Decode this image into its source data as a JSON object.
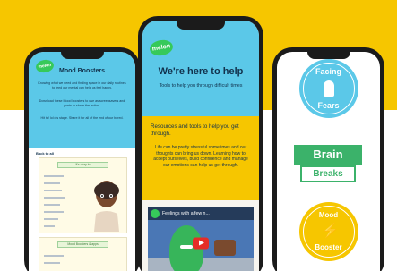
{
  "colors": {
    "accent_yellow": "#f6c600",
    "sky_blue": "#5bc8e8",
    "melon_green": "#36c95a",
    "navy_text": "#12324d",
    "brain_green": "#3bb26a"
  },
  "left_phone": {
    "logo": "melon",
    "title": "Mood Boosters",
    "para1": "Knowing what we need and finding space in our daily routines to feed our mental can help us feel happy.",
    "para2": "Download these Mood boosters to use as screensavers and posts to share the action.",
    "para3": "Hit ta! lol dis stage. Share it for all of the end of our bored.",
    "back_link": "Back to all",
    "card1_header": "It's okay to",
    "card2_header": "Mood Boosters & apps"
  },
  "center_phone": {
    "logo": "melon",
    "title": "We're here to help",
    "subtitle": "Tools to help you through difficult times",
    "resources_heading": "Resources and tools to help you get through.",
    "body": "Life can be pretty stressful sometimes and our thoughts can bring us down. Learning how to accept ourselves, build confidence and manage our emotions can help us get through.",
    "video_title": "Feelings with a few n..."
  },
  "right_phone": {
    "badge1_top": "Facing",
    "badge1_bottom": "Fears",
    "brain": "Brain",
    "breaks": "Breaks",
    "badge2_top": "Mood",
    "badge2_bottom": "Booster"
  }
}
